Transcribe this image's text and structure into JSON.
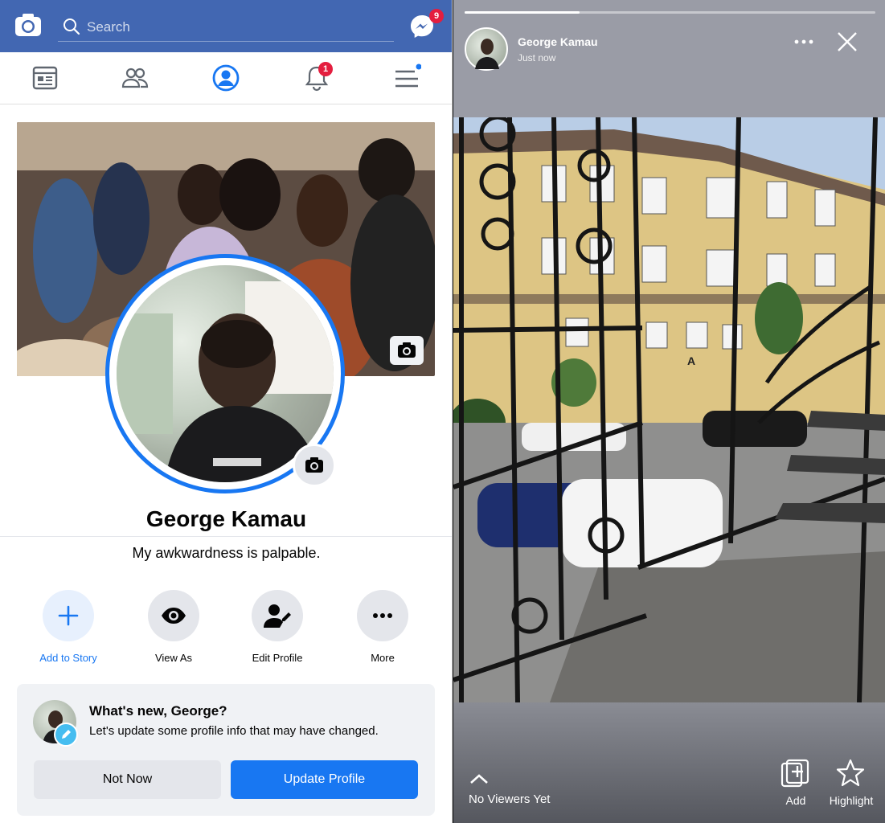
{
  "left": {
    "topbar": {
      "search_placeholder": "Search",
      "messenger_badge": "9",
      "brand_color": "#4267b2"
    },
    "navbar": {
      "items": [
        "news-feed-icon",
        "friends-icon",
        "profile-icon",
        "notifications-icon",
        "menu-icon"
      ],
      "notifications_badge": "1",
      "active_color": "#1877f2"
    },
    "profile": {
      "name": "George Kamau",
      "bio": "My awkwardness is palpable."
    },
    "actions": [
      {
        "label": "Add to Story",
        "icon": "plus-icon"
      },
      {
        "label": "View As",
        "icon": "eye-icon"
      },
      {
        "label": "Edit Profile",
        "icon": "edit-profile-icon"
      },
      {
        "label": "More",
        "icon": "more-dots-icon"
      }
    ],
    "update_card": {
      "title": "What's new, George?",
      "subtitle": "Let's update some profile info that may have changed.",
      "dismiss_label": "Not Now",
      "confirm_label": "Update Profile"
    }
  },
  "right": {
    "story": {
      "author": "George Kamau",
      "time": "Just now",
      "progress": 0.28,
      "photo_sign": "A"
    },
    "footer": {
      "viewers": "No Viewers Yet",
      "add_label": "Add",
      "highlight_label": "Highlight"
    }
  }
}
